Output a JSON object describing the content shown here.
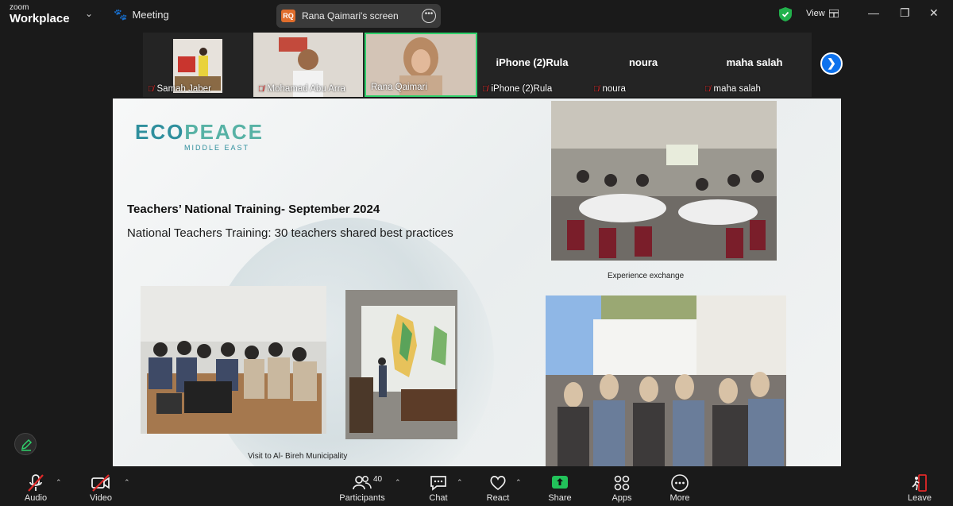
{
  "app": {
    "brand_top": "zoom",
    "brand_bottom": "Workplace",
    "meeting_label": "Meeting"
  },
  "share": {
    "avatar_initials": "RQ",
    "label": "Rana Qaimari's screen"
  },
  "topbar": {
    "view_label": "View"
  },
  "participants_strip": [
    {
      "name": "Samah Jaber",
      "muted": true,
      "video": true
    },
    {
      "name": "Mohamad Abu Arra",
      "muted": true,
      "video": true
    },
    {
      "name": "Rana Qaimari",
      "muted": false,
      "video": true,
      "active_speaker": true
    },
    {
      "name": "iPhone (2)Rula",
      "display": "iPhone (2)Rula",
      "muted": true,
      "video": false
    },
    {
      "name": "noura",
      "display": "noura",
      "muted": true,
      "video": false
    },
    {
      "name": "maha salah",
      "display": "maha salah",
      "muted": true,
      "video": false
    }
  ],
  "slide": {
    "logo_main_a": "ECO",
    "logo_main_b": "PEACE",
    "logo_sub": "MIDDLE EAST",
    "title": "Teachers’ National Training- September 2024",
    "subtitle": "National Teachers Training: 30 teachers shared best practices",
    "caption_experience": "Experience exchange",
    "caption_visit": "Visit to Al- Bireh Municipality"
  },
  "toolbar": {
    "audio": "Audio",
    "video": "Video",
    "participants": "Participants",
    "participants_count": "40",
    "chat": "Chat",
    "react": "React",
    "share": "Share",
    "apps": "Apps",
    "more": "More",
    "leave": "Leave"
  },
  "colors": {
    "active_border": "#2fd06b",
    "share_green": "#22c25a",
    "mute_red": "#e02828",
    "leave_red": "#e02828",
    "accent_blue": "#0e72ed"
  }
}
